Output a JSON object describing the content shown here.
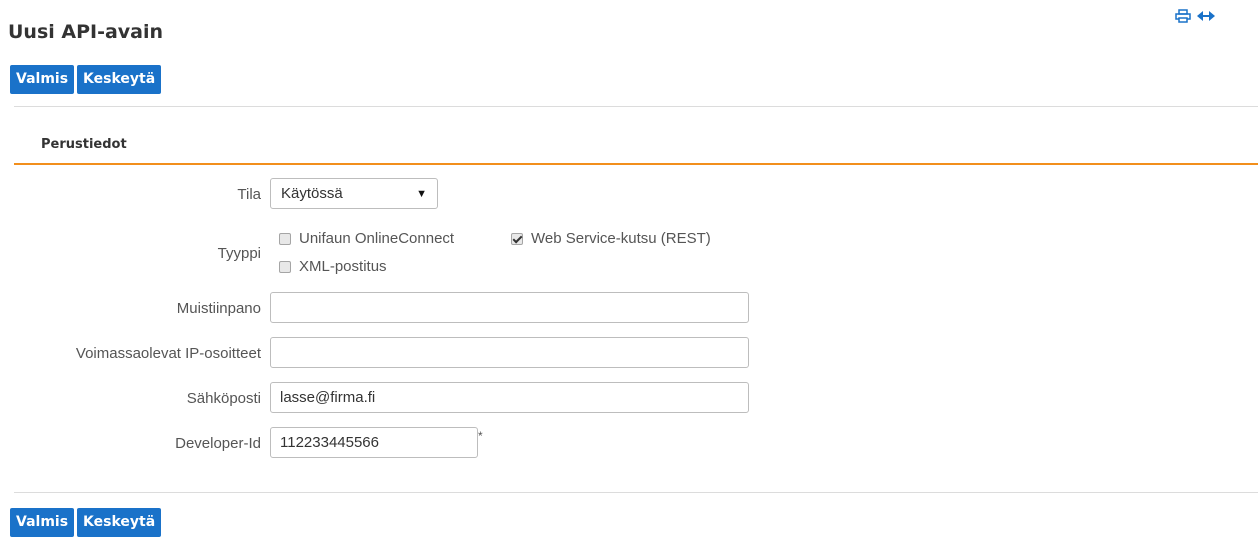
{
  "header": {
    "title": "Uusi API-avain",
    "print_icon": "print-icon",
    "expand_icon": "expand-width-icon"
  },
  "actions": {
    "done_label": "Valmis",
    "cancel_label": "Keskeytä"
  },
  "section": {
    "title": "Perustiedot"
  },
  "form": {
    "status": {
      "label": "Tila",
      "value": "Käytössä"
    },
    "type": {
      "label": "Tyyppi",
      "options": [
        {
          "label": "Unifaun OnlineConnect",
          "checked": false
        },
        {
          "label": "Web Service-kutsu (REST)",
          "checked": true
        },
        {
          "label": "XML-postitus",
          "checked": false
        }
      ]
    },
    "note": {
      "label": "Muistiinpano",
      "value": ""
    },
    "ip": {
      "label": "Voimassaolevat IP-osoitteet",
      "value": ""
    },
    "email": {
      "label": "Sähköposti",
      "value": "lasse@firma.fi"
    },
    "developer_id": {
      "label": "Developer-Id",
      "value": "112233445566",
      "required_mark": "*"
    }
  },
  "colors": {
    "button": "#1a72c9",
    "accent_line": "#f28f1c",
    "icon": "#1a72c9"
  }
}
